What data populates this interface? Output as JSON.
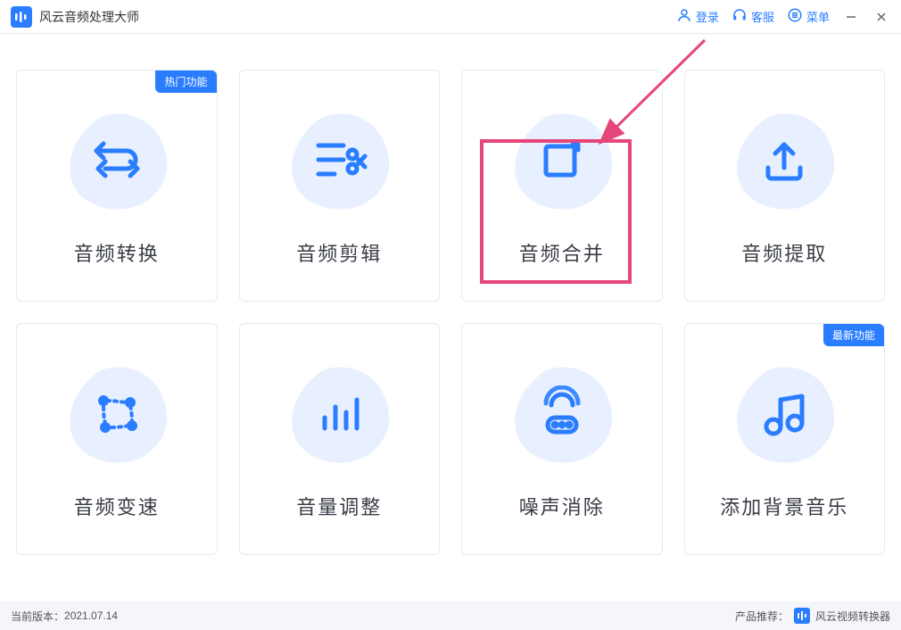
{
  "app": {
    "title": "风云音频处理大师"
  },
  "titlebar": {
    "login": "登录",
    "service": "客服",
    "menu": "菜单"
  },
  "cards": [
    {
      "label": "音频转换",
      "badge": "热门功能",
      "icon": "convert"
    },
    {
      "label": "音频剪辑",
      "badge": null,
      "icon": "cut"
    },
    {
      "label": "音频合并",
      "badge": null,
      "icon": "merge"
    },
    {
      "label": "音频提取",
      "badge": null,
      "icon": "extract"
    },
    {
      "label": "音频变速",
      "badge": null,
      "icon": "speed"
    },
    {
      "label": "音量调整",
      "badge": null,
      "icon": "volume"
    },
    {
      "label": "噪声消除",
      "badge": null,
      "icon": "noise"
    },
    {
      "label": "添加背景音乐",
      "badge": "最新功能",
      "icon": "bgmusic"
    }
  ],
  "footer": {
    "version_label": "当前版本：",
    "version": "2021.07.14",
    "recommend_label": "产品推荐：",
    "recommend_product": "风云视频转换器"
  },
  "colors": {
    "primary": "#2a7dff",
    "icon_bg": "#e8f0ff",
    "annotation": "#e6467a"
  }
}
